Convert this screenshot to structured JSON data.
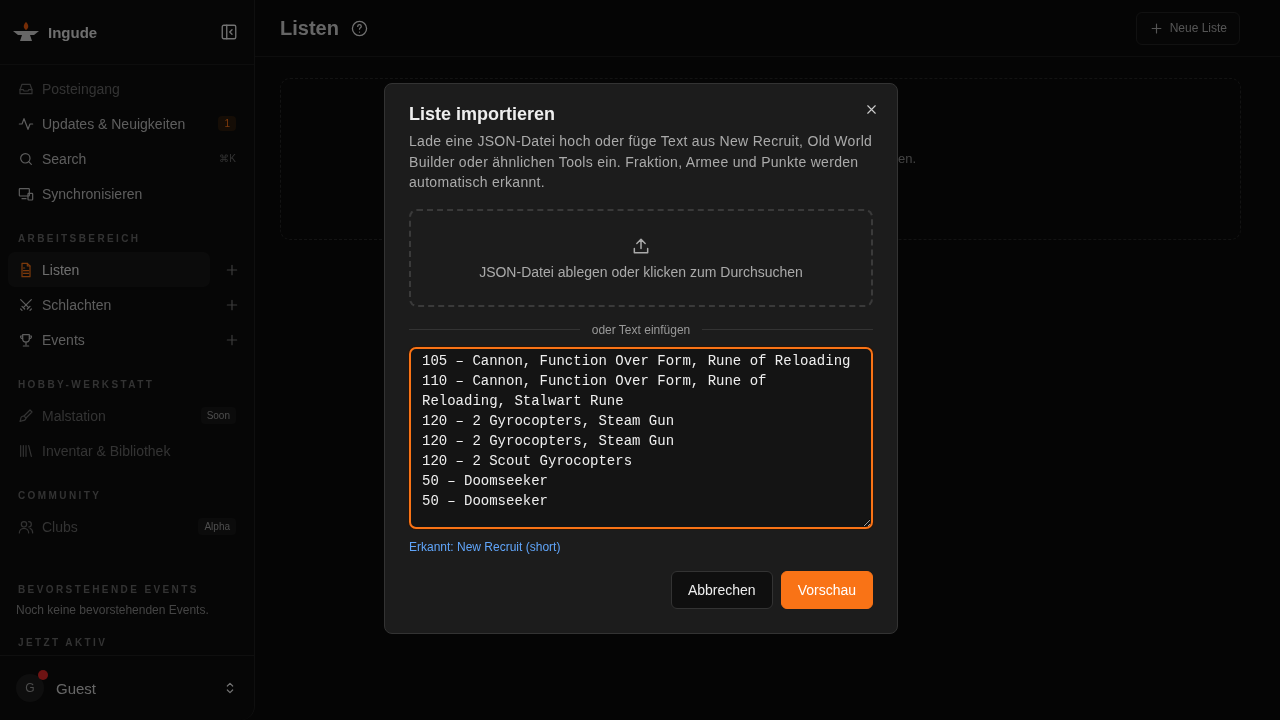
{
  "sidebar": {
    "brand": "Ingude",
    "top_items": [
      {
        "label": "Posteingang",
        "disabled": true
      },
      {
        "label": "Updates & Neuigkeiten",
        "disabled": false,
        "badge": "1"
      },
      {
        "label": "Search",
        "disabled": false,
        "shortcut": "⌘K"
      },
      {
        "label": "Synchronisieren",
        "disabled": false
      }
    ],
    "sections": [
      {
        "title": "ARBEITSBEREICH",
        "items": [
          {
            "label": "Listen",
            "selected": true,
            "disabled": false,
            "add": true
          },
          {
            "label": "Schlachten",
            "selected": false,
            "disabled": false,
            "add": true
          },
          {
            "label": "Events",
            "selected": false,
            "disabled": false,
            "add": true
          }
        ]
      },
      {
        "title": "HOBBY-WERKSTATT",
        "items": [
          {
            "label": "Malstation",
            "selected": false,
            "disabled": true,
            "tag": "Soon"
          },
          {
            "label": "Inventar & Bibliothek",
            "selected": false,
            "disabled": true
          }
        ]
      },
      {
        "title": "COMMUNITY",
        "items": [
          {
            "label": "Clubs",
            "selected": false,
            "disabled": true,
            "tag": "Alpha"
          }
        ]
      }
    ],
    "upcoming": {
      "title": "BEVORSTEHENDE EVENTS",
      "text": "Noch keine bevorstehenden Events."
    },
    "active": {
      "title": "JETZT AKTIV"
    },
    "user": {
      "initial": "G",
      "name": "Guest",
      "notification": true
    }
  },
  "header": {
    "title": "Listen",
    "new_button": "Neue Liste"
  },
  "empty_state": {
    "text_visible": "en."
  },
  "dialog": {
    "title": "Liste importieren",
    "description": "Lade eine JSON-Datei hoch oder füge Text aus New Recruit, Old World Builder oder ähnlichen Tools ein. Fraktion, Armee und Punkte werden automatisch erkannt.",
    "dropzone": "JSON-Datei ablegen oder klicken zum Durchsuchen",
    "divider": "oder Text einfügen",
    "text_lines": [
      "105 – Cannon, Function Over Form, Rune of Reloading",
      "110 – Cannon, Function Over Form, Rune of Reloading, Stalwart Rune",
      "120 – 2 Gyrocopters, Steam Gun",
      "120 – 2 Gyrocopters, Steam Gun",
      "120 – 2 Scout Gyrocopters",
      "50 – Doomseeker",
      "50 – Doomseeker"
    ],
    "focused": true,
    "detected": "Erkannt: New Recruit (short)",
    "buttons": [
      {
        "label": "Abbrechen",
        "kind": "secondary"
      },
      {
        "label": "Vorschau",
        "kind": "primary"
      }
    ]
  }
}
